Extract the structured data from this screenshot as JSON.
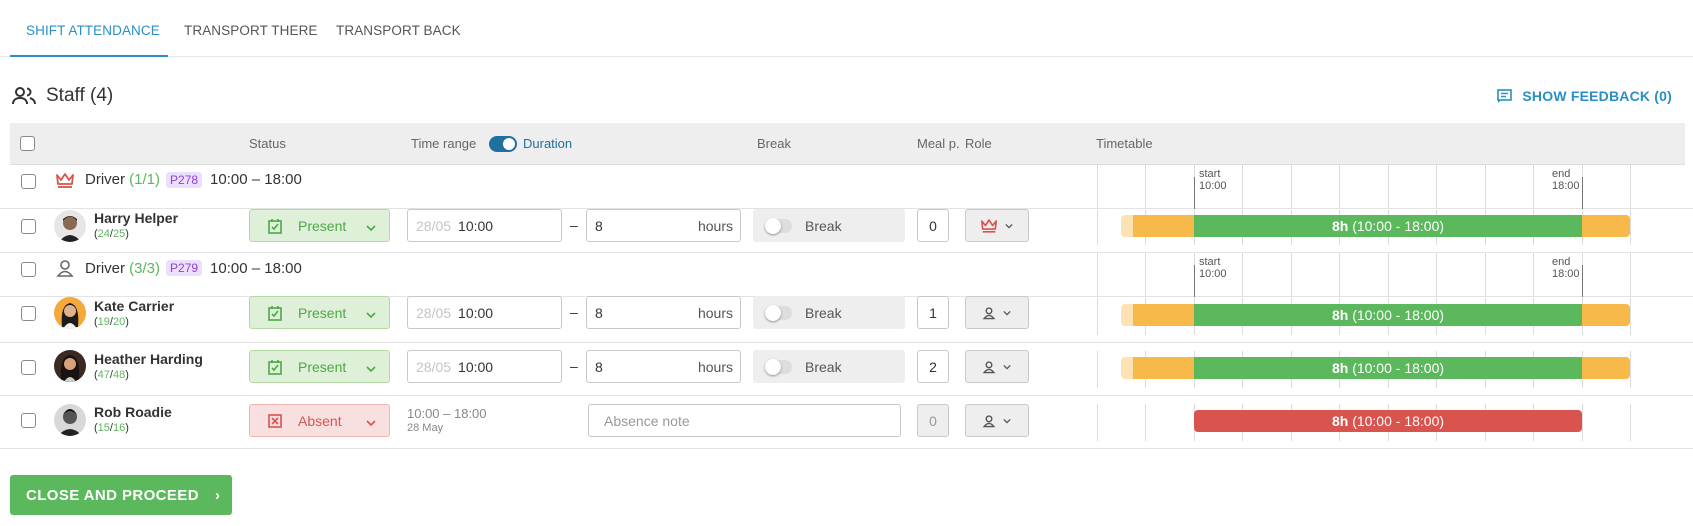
{
  "tabs": [
    {
      "label": "SHIFT ATTENDANCE",
      "active": true
    },
    {
      "label": "TRANSPORT THERE",
      "active": false
    },
    {
      "label": "TRANSPORT BACK",
      "active": false
    }
  ],
  "staff": {
    "title": "Staff (4)",
    "feedback_label": "SHOW FEEDBACK (0)"
  },
  "columns": {
    "status": "Status",
    "time_range": "Time range",
    "duration": "Duration",
    "break": "Break",
    "meal": "Meal p.",
    "role": "Role",
    "timetable": "Timetable"
  },
  "groups": [
    {
      "title": "Driver",
      "count": "(1/1)",
      "code": "P278",
      "time": "10:00 – 18:00",
      "role_icon": "crown-icon"
    },
    {
      "title": "Driver",
      "count": "(3/3)",
      "code": "P279",
      "time": "10:00 – 18:00",
      "role_icon": "person-icon"
    }
  ],
  "timeline_labels": {
    "start": "start",
    "end": "end",
    "start_time": "10:00",
    "end_time": "18:00"
  },
  "people": [
    {
      "name": "Harry Helper",
      "count_a": "24",
      "count_b": "25",
      "status": "Present",
      "date": "28/05",
      "time": "10:00",
      "duration": "8",
      "unit": "hours",
      "break": "Break",
      "meal": "0",
      "bar": "8h",
      "bar_range": "(10:00 - 18:00)"
    },
    {
      "name": "Kate Carrier",
      "count_a": "19",
      "count_b": "20",
      "status": "Present",
      "date": "28/05",
      "time": "10:00",
      "duration": "8",
      "unit": "hours",
      "break": "Break",
      "meal": "1",
      "bar": "8h",
      "bar_range": "(10:00 - 18:00)"
    },
    {
      "name": "Heather Harding",
      "count_a": "47",
      "count_b": "48",
      "status": "Present",
      "date": "28/05",
      "time": "10:00",
      "duration": "8",
      "unit": "hours",
      "break": "Break",
      "meal": "2",
      "bar": "8h",
      "bar_range": "(10:00 - 18:00)"
    },
    {
      "name": "Rob Roadie",
      "count_a": "15",
      "count_b": "16",
      "status": "Absent",
      "time_range": "10:00 – 18:00",
      "date_text": "28 May",
      "note_placeholder": "Absence note",
      "meal": "0",
      "bar": "8h",
      "bar_range": "(10:00 - 18:00)"
    }
  ],
  "colors": {
    "accent": "#2a8fc4",
    "present": "#5cb85c",
    "absent": "#d9534f",
    "buffer": "#f6b94a"
  },
  "proceed_label": "CLOSE AND PROCEED"
}
